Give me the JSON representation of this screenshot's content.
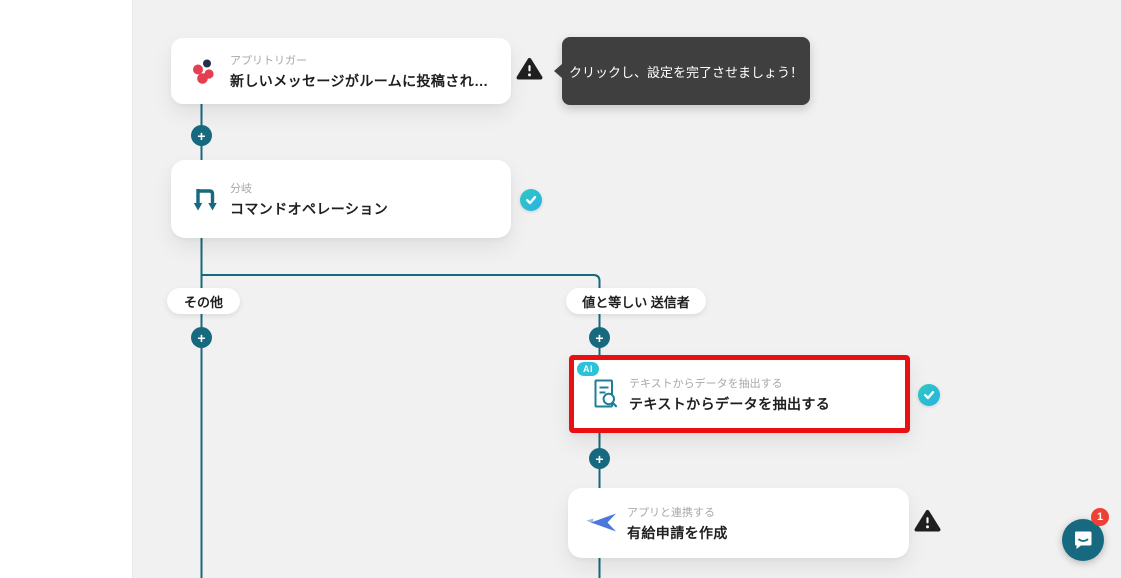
{
  "workflow": {
    "nodes": [
      {
        "kind": "アプリトリガー",
        "title": "新しいメッセージがルームに投稿され…",
        "status": "warning",
        "icon": "chatwork-dots-icon"
      },
      {
        "kind": "分岐",
        "title": "コマンドオペレーション",
        "status": "done",
        "icon": "branch-icon"
      },
      {
        "kind": "テキストからデータを抽出する",
        "title": "テキストからデータを抽出する",
        "status": "done",
        "badge": "AI",
        "highlighted": true,
        "icon": "extract-text-icon"
      },
      {
        "kind": "アプリと連携する",
        "title": "有給申請を作成",
        "status": "warning",
        "icon": "app-integration-bird-icon"
      }
    ],
    "branches": {
      "left_label": "その他",
      "right_label": "値と等しい 送信者"
    },
    "add_button_label": "+"
  },
  "tooltip": {
    "text": "クリックし、設定を完了させましょう！"
  },
  "chat_widget": {
    "unread_count": "1"
  },
  "colors": {
    "canvas_bg": "#f1f1f2",
    "accent_teal": "#16697e",
    "icon_teal": "#1d7f95",
    "check_gradient_start": "#2fc8c0",
    "check_gradient_end": "#26b3e6",
    "highlight_red": "#e81010",
    "ai_badge": "#2cc3da",
    "warning": "#1f1f1f",
    "tooltip_bg": "#3f3f3f",
    "chat_badge": "#ee4035"
  }
}
